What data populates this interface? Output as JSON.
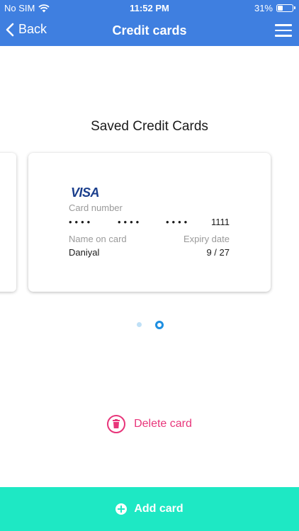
{
  "status_bar": {
    "carrier": "No SIM",
    "time": "11:52 PM",
    "battery_percent_text": "31%",
    "battery_level": 0.31
  },
  "nav": {
    "back_label": "Back",
    "title": "Credit cards"
  },
  "section_title": "Saved Credit Cards",
  "card": {
    "brand": "VISA",
    "number_label": "Card number",
    "dots_groups": [
      "••••",
      "••••",
      "••••"
    ],
    "last4": "1111",
    "name_label": "Name on card",
    "name": "Daniyal",
    "expiry_label": "Expiry date",
    "expiry": "9 / 27"
  },
  "pager": {
    "total": 2,
    "active_index": 1
  },
  "delete_label": "Delete card",
  "add_card_label": "Add card",
  "colors": {
    "header_blue": "#3f7fe0",
    "delete_pink": "#e8357a",
    "add_bar_teal": "#1ee8c4",
    "pager_active": "#1e8fe1"
  }
}
